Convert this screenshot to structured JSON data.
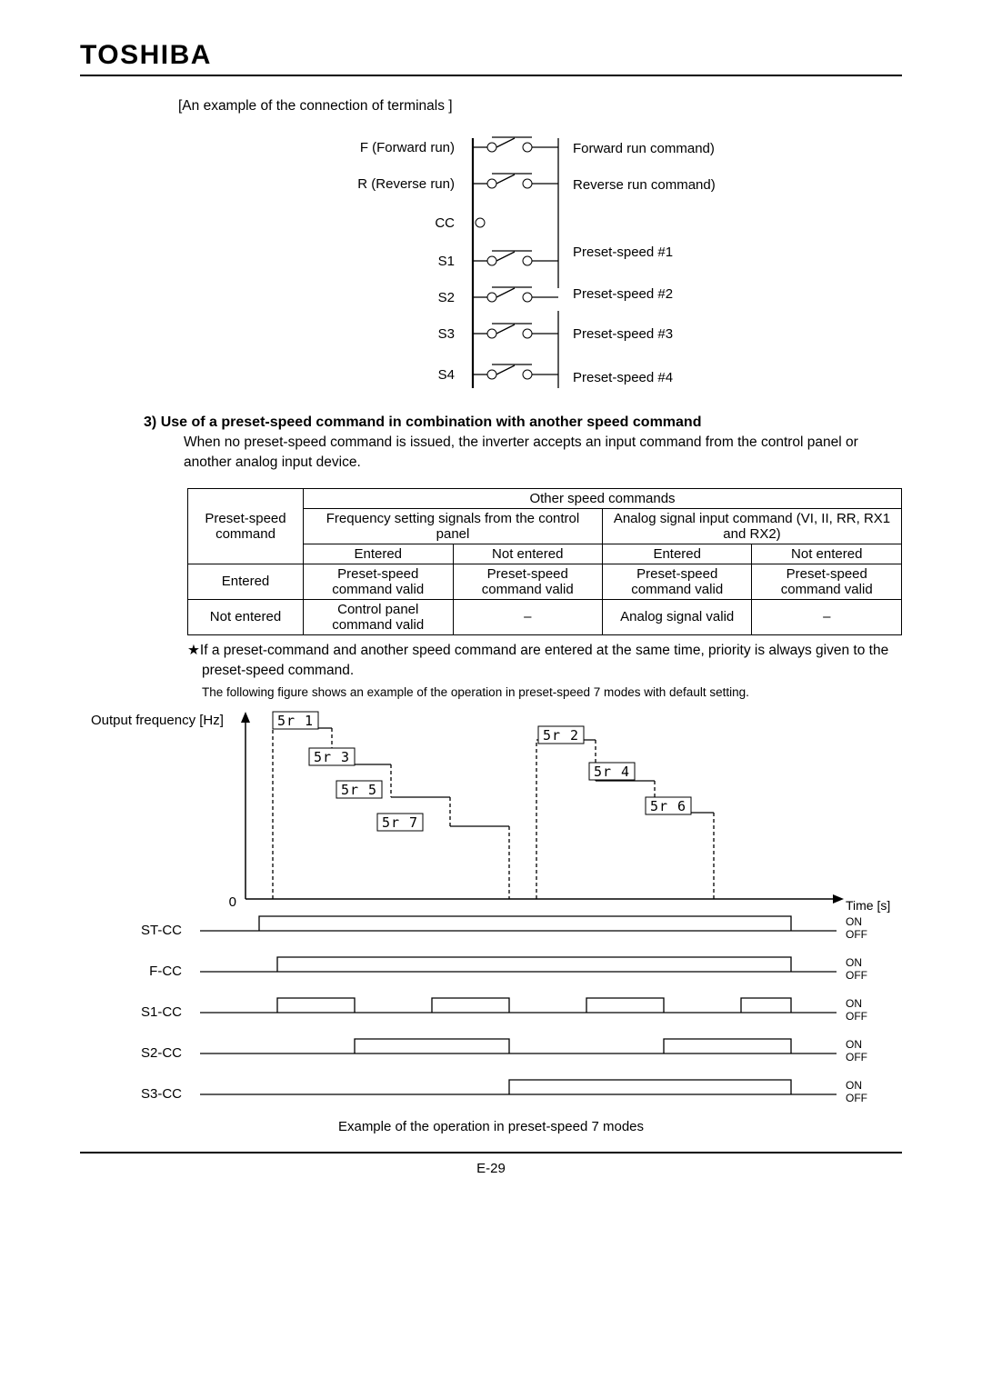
{
  "brand": "TOSHIBA",
  "caption": "[An example of the connection of terminals ]",
  "terminals": {
    "left": [
      {
        "name": "F (Forward run)",
        "desc": "Forward run command)",
        "switch": true
      },
      {
        "name": "R (Reverse run)",
        "desc": "Reverse run command)",
        "switch": true
      },
      {
        "name": "CC",
        "desc": "",
        "switch": false
      },
      {
        "name": "S1",
        "desc": "Preset-speed #1",
        "switch": true
      },
      {
        "name": "S2",
        "desc": "Preset-speed #2",
        "switch": true
      },
      {
        "name": "S3",
        "desc": "Preset-speed #3",
        "switch": true
      },
      {
        "name": "S4",
        "desc": "Preset-speed #4",
        "switch": true
      }
    ]
  },
  "section": {
    "num": "3)",
    "title": "Use of a preset-speed command in combination with another speed command",
    "body": "When no preset-speed command is issued, the inverter accepts an input command from the control panel or another analog input device."
  },
  "table": {
    "rowhead": "Preset-speed command",
    "colhead": "Other speed commands",
    "col_groups": [
      "Frequency setting signals from the control panel",
      "Analog signal input command (VI, II, RR, RX1 and RX2)"
    ],
    "sub_cols": [
      "Entered",
      "Not entered",
      "Entered",
      "Not entered"
    ],
    "rows": [
      {
        "label": "Entered",
        "cells": [
          "Preset-speed command valid",
          "Preset-speed command valid",
          "Preset-speed command valid",
          "Preset-speed command valid"
        ]
      },
      {
        "label": "Not entered",
        "cells": [
          "Control panel command valid",
          "–",
          "Analog signal valid",
          "–"
        ]
      }
    ]
  },
  "note": "★If a preset-command and another speed command are entered at the same time, priority is always given to the preset-speed command.",
  "note2": "The following figure shows an example of the operation in preset-speed 7 modes with default setting.",
  "timing": {
    "ylabel": "Output frequency [Hz]",
    "xlabel": "Time [s]",
    "zero": "0",
    "on": "ON",
    "off": "OFF",
    "sr_labels": [
      "5r 1",
      "5r 2",
      "5r 3",
      "5r 4",
      "5r 5",
      "5r 6",
      "5r 7"
    ],
    "signals": [
      "ST-CC",
      "F-CC",
      "S1-CC",
      "S2-CC",
      "S3-CC"
    ],
    "bottom_caption": "Example of the operation in preset-speed 7 modes"
  },
  "page_number": "E-29",
  "chart_data": {
    "type": "line",
    "title": "Output frequency vs time — preset-speed 7 modes example",
    "xlabel": "Time [s]",
    "ylabel": "Output frequency [Hz]",
    "ylim": [
      0,
      100
    ],
    "annotations": [
      "5r1",
      "5r2",
      "5r3",
      "5r4",
      "5r5",
      "5r6",
      "5r7"
    ],
    "series": [
      {
        "name": "Output frequency",
        "x": [
          0,
          1,
          2,
          3,
          4,
          5,
          6,
          7,
          8,
          9,
          10,
          11,
          12,
          13,
          14,
          15,
          16
        ],
        "values": [
          0,
          0,
          100,
          70,
          55,
          45,
          35,
          0,
          95,
          60,
          50,
          0,
          0,
          0,
          0,
          0,
          0
        ]
      }
    ],
    "digital_signals": [
      {
        "name": "ST-CC",
        "high_intervals": [
          [
            1,
            15
          ]
        ]
      },
      {
        "name": "F-CC",
        "high_intervals": [
          [
            1.6,
            15
          ]
        ]
      },
      {
        "name": "S1-CC",
        "high_intervals": [
          [
            1.6,
            3.2
          ],
          [
            4.8,
            6.4
          ],
          [
            8,
            9.6
          ],
          [
            11.2,
            12.8
          ]
        ]
      },
      {
        "name": "S2-CC",
        "high_intervals": [
          [
            3.2,
            6.4
          ],
          [
            9.6,
            12.8
          ]
        ]
      },
      {
        "name": "S3-CC",
        "high_intervals": [
          [
            6.4,
            12.8
          ]
        ]
      }
    ]
  }
}
